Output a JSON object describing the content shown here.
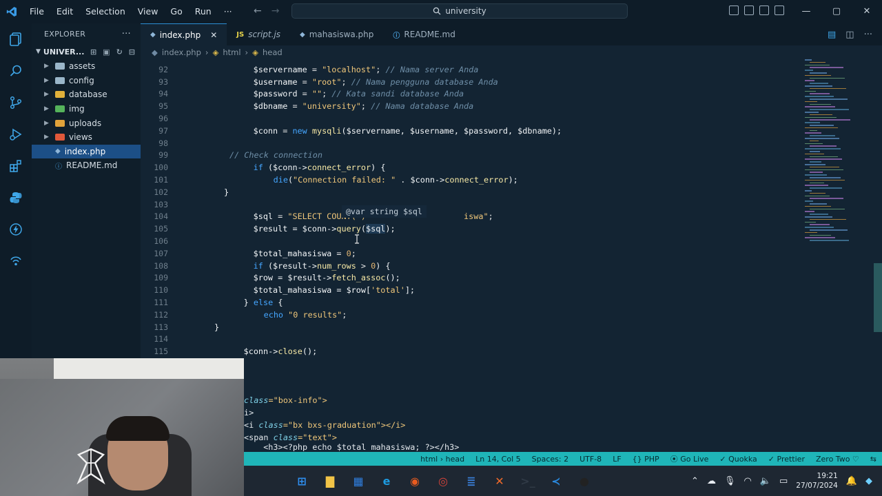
{
  "titlebar": {
    "menu": [
      "File",
      "Edit",
      "Selection",
      "View",
      "Go",
      "Run",
      "···"
    ],
    "search": "university",
    "window_controls": [
      "—",
      "▢",
      "✕"
    ]
  },
  "explorer": {
    "header": "EXPLORER",
    "project": "UNIVER...",
    "folders": [
      {
        "name": "assets",
        "color": "#9ab6c9"
      },
      {
        "name": "config",
        "color": "#9ab6c9"
      },
      {
        "name": "database",
        "color": "#e0b03a"
      },
      {
        "name": "img",
        "color": "#55b35b"
      },
      {
        "name": "uploads",
        "color": "#e0a23a"
      },
      {
        "name": "views",
        "color": "#e0583a"
      }
    ],
    "files": [
      "index.php",
      "README.md"
    ]
  },
  "tabs": [
    {
      "label": "index.php",
      "icon": "php-icon",
      "active": true,
      "close": "✕"
    },
    {
      "label": "script.js",
      "icon": "js-icon",
      "prefix": "JS"
    },
    {
      "label": "mahasiswa.php",
      "icon": "php-icon"
    },
    {
      "label": "README.md",
      "icon": "info-icon"
    }
  ],
  "breadcrumb": [
    "index.php",
    "html",
    "head"
  ],
  "editor": {
    "lines": [
      {
        "n": "92",
        "indent": 8
      },
      {
        "n": "93",
        "indent": 8
      },
      {
        "n": "94",
        "indent": 8
      },
      {
        "n": "95",
        "indent": 8
      },
      {
        "n": "96",
        "indent": 0
      },
      {
        "n": "97",
        "indent": 8
      },
      {
        "n": "98",
        "indent": 0
      },
      {
        "n": "99",
        "indent": 8
      },
      {
        "n": "100",
        "indent": 8
      },
      {
        "n": "101",
        "indent": 12
      },
      {
        "n": "102",
        "indent": 8
      },
      {
        "n": "103",
        "indent": 0
      },
      {
        "n": "104",
        "indent": 8
      },
      {
        "n": "105",
        "indent": 8
      },
      {
        "n": "106",
        "indent": 0
      },
      {
        "n": "107",
        "indent": 8
      },
      {
        "n": "108",
        "indent": 8
      },
      {
        "n": "109",
        "indent": 8
      },
      {
        "n": "110",
        "indent": 8
      },
      {
        "n": "111",
        "indent": 6
      },
      {
        "n": "112",
        "indent": 10
      },
      {
        "n": "113",
        "indent": 6
      },
      {
        "n": "114",
        "indent": 0
      },
      {
        "n": "115",
        "indent": 6
      }
    ],
    "code": {
      "l92": [
        "$servername",
        " = ",
        "\"localhost\"",
        "; ",
        "// Nama server Anda"
      ],
      "l93": [
        "$username",
        " = ",
        "\"root\"",
        "; ",
        "// Nama pengguna database Anda"
      ],
      "l94": [
        "$password",
        " = ",
        "\"\"",
        "; ",
        "// Kata sandi database Anda"
      ],
      "l95": [
        "$dbname",
        " = ",
        "\"university\"",
        "; ",
        "// Nama database Anda"
      ],
      "l97": [
        "$conn",
        " = ",
        "new",
        " ",
        "mysqli",
        "($servername, $username, $password, $dbname);"
      ],
      "l99": "// Check connection",
      "l100": [
        "if",
        " ($conn->",
        "connect_error",
        ") {"
      ],
      "l101": [
        "die",
        "(",
        "\"Connection failed: \"",
        " . $conn->",
        "connect_error",
        ");"
      ],
      "l102": "}",
      "l104": [
        "$sql",
        " = ",
        "\"SELECT COUNT(*)",
        "                    ",
        "iswa\"",
        ";"
      ],
      "l105": [
        "$result",
        " = $conn->",
        "query",
        "(",
        "$sql",
        ");"
      ],
      "l107": [
        "$total_mahasiswa",
        " = ",
        "0",
        ";"
      ],
      "l108": [
        "if",
        " ($result->",
        "num_rows",
        " > ",
        "0",
        ") {"
      ],
      "l109": [
        "$row",
        " = $result->",
        "fetch_assoc",
        "();"
      ],
      "l110": [
        "$total_mahasiswa",
        " = $row[",
        "'total'",
        "];"
      ],
      "l111": [
        "} ",
        "else",
        " {"
      ],
      "l112": [
        "echo",
        " ",
        "\"0 results\"",
        ";"
      ],
      "l113": "}",
      "l115": [
        "$conn",
        "->",
        "close",
        "();"
      ]
    },
    "hover": "@var string $sql"
  },
  "lower_code": [
    [
      "class",
      "=\"box-info\">"
    ],
    [
      "i>",
      ""
    ],
    [
      "<i ",
      "class",
      "=\"bx bxs-graduation\"></i>"
    ],
    [
      "<span ",
      "class",
      "=\"text\">"
    ],
    [
      "  <h3><?php echo $total_mahasiswa; ?></h3>",
      ""
    ]
  ],
  "statusbar": [
    "html › head",
    "Ln 14, Col 5",
    "Spaces: 2",
    "UTF-8",
    "LF",
    "{} PHP",
    "⦿ Go Live",
    "✓ Quokka",
    "✓ Prettier",
    "Zero Two ♡",
    "⇆"
  ],
  "taskbar": {
    "apps": [
      {
        "name": "start",
        "color": "#2f8ff0",
        "glyph": "⊞"
      },
      {
        "name": "files",
        "color": "#f2c447",
        "glyph": "▇"
      },
      {
        "name": "store",
        "color": "#2f7fe0",
        "glyph": "▦"
      },
      {
        "name": "edge",
        "color": "#1d9be0",
        "glyph": "e"
      },
      {
        "name": "firefox",
        "color": "#e85b1f",
        "glyph": "◉"
      },
      {
        "name": "chrome",
        "color": "#d9443a",
        "glyph": "◎"
      },
      {
        "name": "notepad",
        "color": "#3a7fd8",
        "glyph": "≣"
      },
      {
        "name": "xampp",
        "color": "#f06a2a",
        "glyph": "✕"
      },
      {
        "name": "terminal",
        "color": "#303a46",
        "glyph": ">_"
      },
      {
        "name": "vscode",
        "color": "#2a8ae0",
        "glyph": "≺"
      },
      {
        "name": "obs",
        "color": "#222222",
        "glyph": "●"
      }
    ],
    "time": "19:21",
    "date": "27/07/2024"
  }
}
